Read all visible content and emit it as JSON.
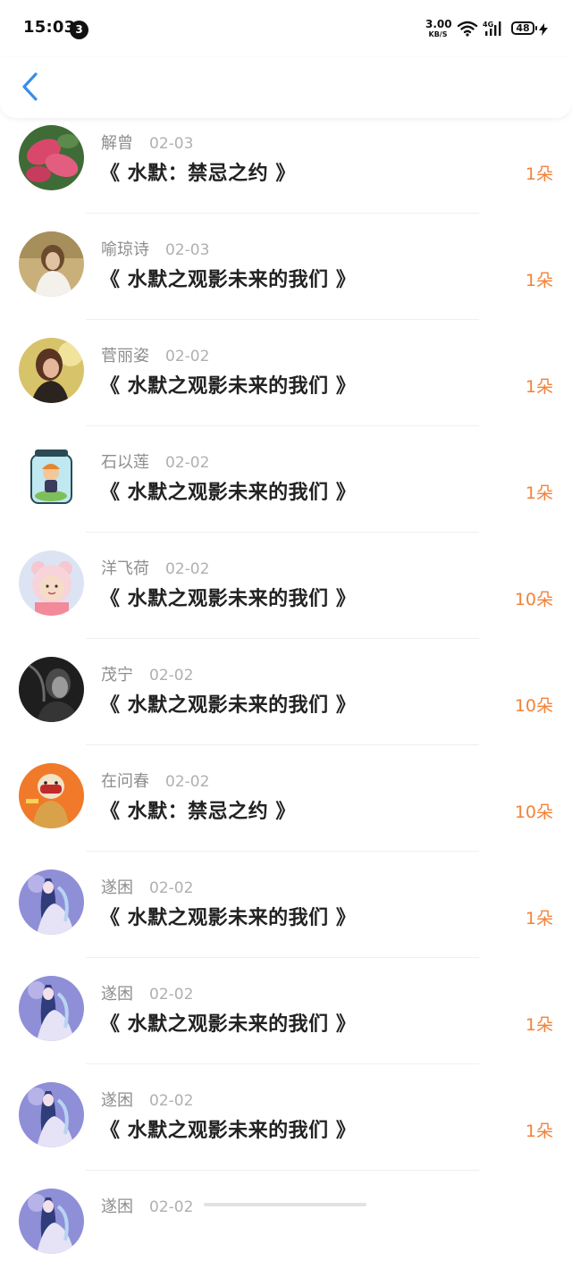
{
  "status_bar": {
    "time": "15:03",
    "notification_count": "3",
    "net_speed_value": "3.00",
    "net_speed_unit": "KB/S",
    "network_type": "4G",
    "battery": "48"
  },
  "header": {
    "back_icon": "chevron-left-icon",
    "accent_color": "#3a8ee6"
  },
  "colors": {
    "amount": "#f2823a",
    "name": "#8e8e8e",
    "title": "#222222"
  },
  "records": [
    {
      "name": "解曾",
      "date": "02-03",
      "title": "《 水默：禁忌之约 》",
      "amount": "1朵",
      "avatar": "red-foliage-avatar"
    },
    {
      "name": "喻琼诗",
      "date": "02-03",
      "title": "《 水默之观影未来的我们 》",
      "amount": "1朵",
      "avatar": "girl-photo-avatar"
    },
    {
      "name": "菅丽姿",
      "date": "02-02",
      "title": "《 水默之观影未来的我们 》",
      "amount": "1朵",
      "avatar": "woman-photo-avatar"
    },
    {
      "name": "石以莲",
      "date": "02-02",
      "title": "《 水默之观影未来的我们 》",
      "amount": "1朵",
      "avatar": "jar-cartoon-avatar"
    },
    {
      "name": "洋飞荷",
      "date": "02-02",
      "title": "《 水默之观影未来的我们 》",
      "amount": "10朵",
      "avatar": "bear-hood-avatar"
    },
    {
      "name": "茂宁",
      "date": "02-02",
      "title": "《 水默之观影未来的我们 》",
      "amount": "10朵",
      "avatar": "dark-portrait-avatar"
    },
    {
      "name": "在问春",
      "date": "02-02",
      "title": "《 水默：禁忌之约 》",
      "amount": "10朵",
      "avatar": "orange-character-avatar"
    },
    {
      "name": "遂困",
      "date": "02-02",
      "title": "《 水默之观影未来的我们 》",
      "amount": "1朵",
      "avatar": "anime-purple-avatar"
    },
    {
      "name": "遂困",
      "date": "02-02",
      "title": "《 水默之观影未来的我们 》",
      "amount": "1朵",
      "avatar": "anime-purple-avatar"
    },
    {
      "name": "遂困",
      "date": "02-02",
      "title": "《 水默之观影未来的我们 》",
      "amount": "1朵",
      "avatar": "anime-purple-avatar"
    },
    {
      "name": "遂困",
      "date": "02-02",
      "title": "",
      "amount": "",
      "avatar": "anime-purple-avatar"
    }
  ]
}
